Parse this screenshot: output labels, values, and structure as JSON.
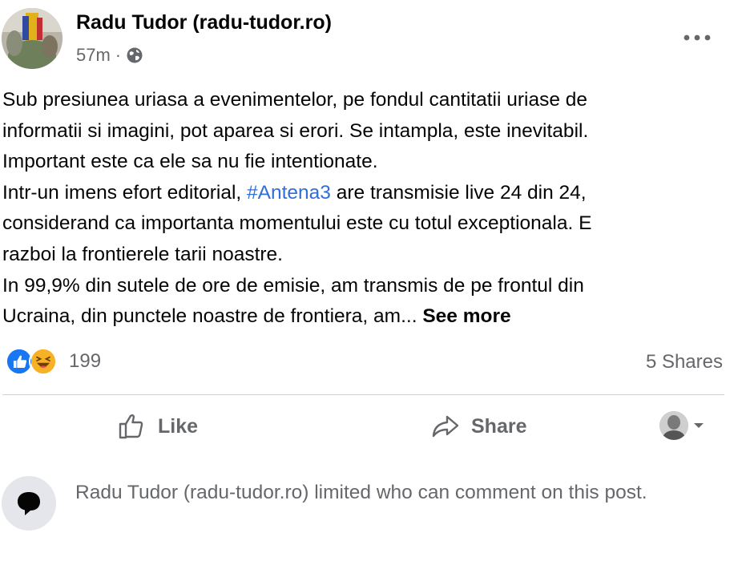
{
  "post": {
    "author": "Radu Tudor (radu-tudor.ro)",
    "time": "57m",
    "separator": "·",
    "audience_icon": "globe-icon",
    "more_icon": "more-horizontal-icon",
    "text_lines": [
      "Sub presiunea uriasa a evenimentelor, pe fondul cantitatii uriase de",
      "informatii si imagini, pot aparea si erori. Se intampla, este inevitabil.",
      "Important este ca ele sa nu fie intentionate."
    ],
    "line4_before": "Intr-un imens efort editorial, ",
    "hashtag": "#Antena3",
    "line4_after": " are transmisie live 24 din 24,",
    "text_lines_2": [
      "considerand ca importanta momentului este cu totul exceptionala. E",
      "razboi la frontierele tarii noastre.",
      "In 99,9% din sutele de ore de emisie, am transmis de pe frontul din"
    ],
    "last_line": "Ucraina, din punctele noastre de frontiera, am... ",
    "see_more": "See more"
  },
  "stats": {
    "reactions": [
      "like-reaction-icon",
      "haha-reaction-icon"
    ],
    "reaction_count": "199",
    "shares": "5 Shares"
  },
  "actions": {
    "like_label": "Like",
    "share_label": "Share"
  },
  "comment_notice": "Radu Tudor (radu-tudor.ro) limited who can comment on this post.",
  "colors": {
    "text": "#050505",
    "secondary": "#65676b",
    "hashtag": "#2f6fd6",
    "like_blue": "#1877f2",
    "haha_yellow": "#f7b125"
  }
}
